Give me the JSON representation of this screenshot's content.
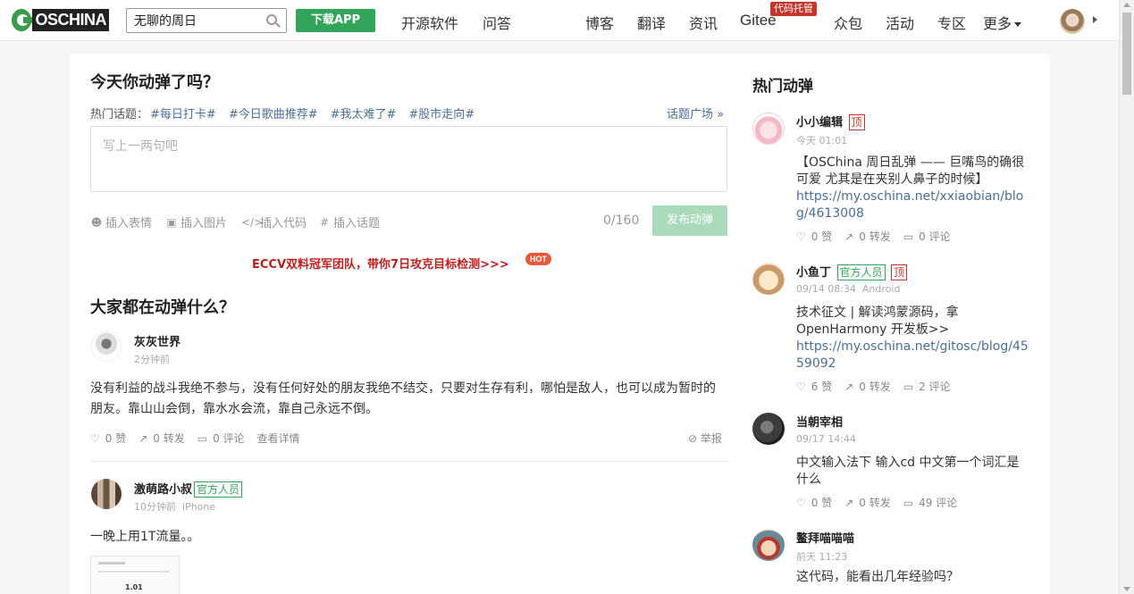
{
  "nav": {
    "logo_text": "OSCHINA",
    "search_value": "无聊的周日",
    "download_label": "下载APP",
    "links_left": [
      "开源软件",
      "问答"
    ],
    "links_right": [
      "博客",
      "翻译",
      "资讯",
      "Gitee",
      "众包",
      "活动",
      "专区",
      "更多"
    ],
    "gitee_badge": "代码托管"
  },
  "compose": {
    "title": "今天你动弹了吗？",
    "hot_topics_label": "热门话题：",
    "hot_topics": [
      "#每日打卡#",
      "#今日歌曲推荐#",
      "#我太难了#",
      "#股市走向#"
    ],
    "topic_plaza": "话题广场 »",
    "placeholder": "写上一两句吧",
    "tools": [
      "插入表情",
      "插入图片",
      "插入代码",
      "插入话题"
    ],
    "counter": "0/160",
    "publish_label": "发布动弹"
  },
  "ad": {
    "text": "ECCV双料冠军团队，带你7日攻克目标检测>>>",
    "hot_label": "HOT"
  },
  "feed": {
    "title": "大家都在动弹什么？",
    "posts": [
      {
        "user": "灰灰世界",
        "time": "2分钟前",
        "content": "没有利益的战斗我绝不参与，没有任何好处的朋友我绝不结交，只要对生存有利，哪怕是敌人，也可以成为暂时的朋友。靠山山会倒，靠水水会流，靠自己永远不倒。",
        "likes": "0 赞",
        "reposts": "0 转发",
        "comments": "0 评论",
        "detail": "查看详情",
        "report": "举报"
      },
      {
        "user": "激萌路小叔",
        "badge": "官方人员",
        "time": "10分钟前",
        "device": "iPhone",
        "content": "一晚上用1T流量。。",
        "thumb_value": "1.01"
      }
    ]
  },
  "hot": {
    "title": "热门动弹",
    "items": [
      {
        "user": "小小编辑",
        "top_badge": "顶",
        "time": "今天 01:01",
        "text": "【OSChina 周日乱弹 —— 巨嘴鸟的确很可爱 尤其是在夹别人鼻子的时候】",
        "link": "https://my.oschina.net/xxiaobian/blog/4613008",
        "likes": "0 赞",
        "reposts": "0 转发",
        "comments": "0 评论"
      },
      {
        "user": "小鱼丁",
        "badge": "官方人员",
        "top_badge": "顶",
        "time": "09/14 08:34",
        "device": "Android",
        "text": "技术征文 | 解读鸿蒙源码，拿OpenHarmony 开发板>>",
        "link": "https://my.oschina.net/gitosc/blog/4559092",
        "likes": "6 赞",
        "reposts": "0 转发",
        "comments": "2 评论"
      },
      {
        "user": "当朝宰相",
        "time": "09/17 14:44",
        "text": "中文输入法下 输入cd 中文第一个词汇是什么",
        "likes": "0 赞",
        "reposts": "0 转发",
        "comments": "49 评论"
      },
      {
        "user": "鳌拜喵喵喵",
        "time": "前天 11:23",
        "text": "这代码，能看出几年经验吗？"
      }
    ]
  }
}
